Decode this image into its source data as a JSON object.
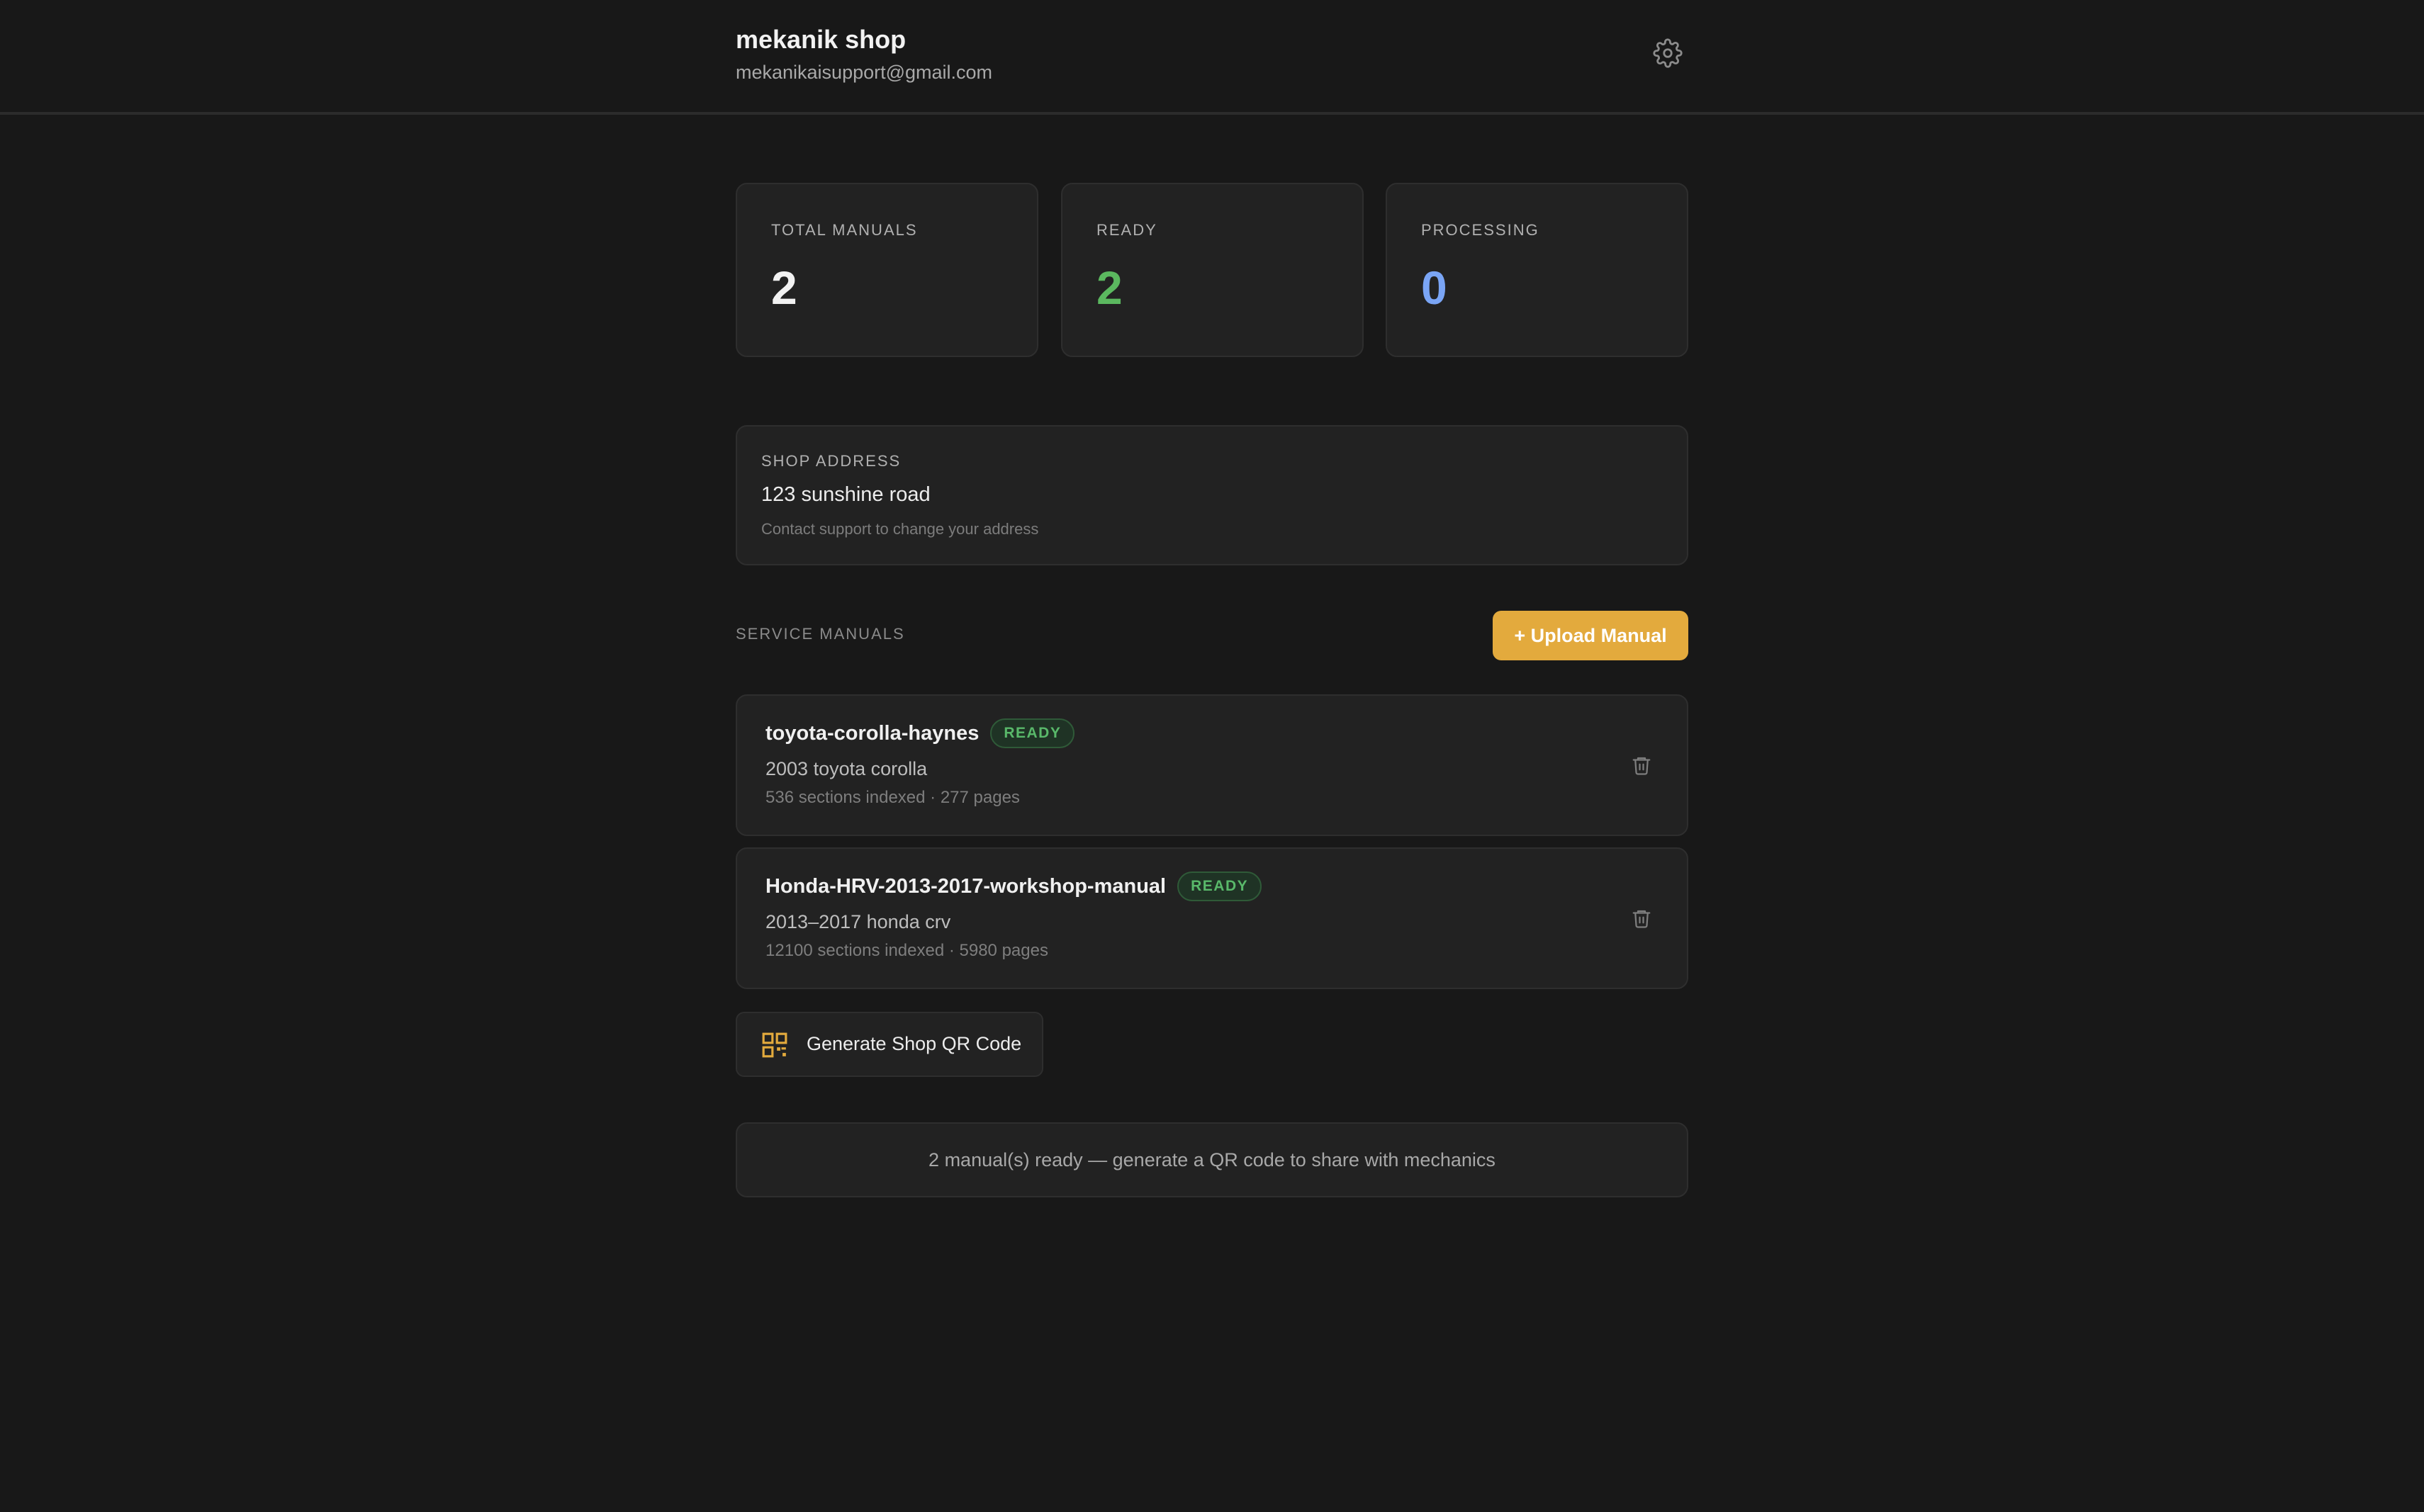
{
  "header": {
    "shop_name": "mekanik shop",
    "email": "mekanikaisupport@gmail.com",
    "settings_icon": "gear-icon"
  },
  "stats": [
    {
      "label": "TOTAL MANUALS",
      "value": "2",
      "color": "#f2f2f2"
    },
    {
      "label": "READY",
      "value": "2",
      "color": "#5bb85f"
    },
    {
      "label": "PROCESSING",
      "value": "0",
      "color": "#7aa5f5"
    }
  ],
  "address": {
    "label": "SHOP ADDRESS",
    "value": "123 sunshine road",
    "note": "Contact support to change your address"
  },
  "manuals_section": {
    "title": "SERVICE MANUALS",
    "upload_label": "+ Upload Manual"
  },
  "manuals": [
    {
      "name": "toyota-corolla-haynes",
      "status": "READY",
      "vehicle": "2003 toyota corolla",
      "meta": "536 sections indexed · 277 pages"
    },
    {
      "name": "Honda-HRV-2013-2017-workshop-manual",
      "status": "READY",
      "vehicle": "2013–2017 honda crv",
      "meta": "12100 sections indexed · 5980 pages"
    }
  ],
  "qr": {
    "label": "Generate Shop QR Code",
    "icon": "qr-code-icon"
  },
  "info_banner": {
    "text": "2 manual(s) ready — generate a QR code to share with mechanics"
  },
  "colors": {
    "background": "#181818",
    "card": "#222222",
    "accent": "#e3aa3d",
    "ready_green": "#59b86a",
    "processing_blue": "#7aa5f5"
  }
}
